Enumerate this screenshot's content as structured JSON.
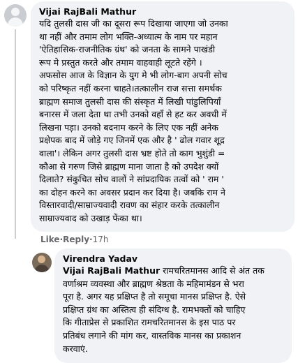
{
  "comments": [
    {
      "author": "Vijai RajBali Mathur",
      "text": "यदि तुलसी दास जी का दूसरा रूप दिखाया जाएगा जो उनका\nथा नहीं और तमाम लोग भक्ति-अध्यात्म के नाम पर महान\n'ऐतिहासिक-राजनीतिक ग्रंथ' को जनता के सामने पाखंडी\nरूप मे प्रस्तुत करते और तमाम वाहवाही लूटते रहेंगे ।\nअफसोस आज के विज्ञान के युग मे भी लोग-बाग अपनी सोच\nको परिष्कृत नहीं करना चाहते।तत्कालीन राज सत्ता समर्थक\nब्राह्मण समाज तुलसी दास की संस्कृत में लिखी पांडुलिपियाँ\nबनारस में जला देता था तभी उनको वहाँ से हट कर अवधी में\nलिखना पड़ा। उनको बदनाम करने के लिए एक नहीं अनेक\nप्रक्षेपक बाद में जोड़े गए जिनमें एक और है ' ढोल गवार शूद्र\nवाला'। लेकिन अगर तुलसी दास भ्रष्ट होते तो काग भुशुंडी =\nकौआ से गरुण जिसे ब्राह्मण माना जाता है को उपदेश क्यों\nदिलाते? संकुचित सोच वालों ने सांप्रदायिक तत्वों को ' राम '\nका दोहन करने का अवसर प्रदान कर दिया है। जबकि राम ने\nविस्तारवादी/साम्राज्यवादी रावण का संहार करके तत्कालीन\nसाम्राज्यवाद को उखाड़ फेंका था।",
      "actions": {
        "like": "Like",
        "sep1": " · ",
        "reply": "Reply",
        "sep2": " · ",
        "time": "17h"
      }
    },
    {
      "author": "Virendra Yadav",
      "mention": "Vijai RajBali Mathur",
      "text": " रामचरितमानस आदि से अंत तक\nवर्णाश्रम व्यवस्था और ब्राह्मण श्रेष्ठता के महिमामंडन से भरा\nपूरा है. अगर यह प्रक्षिप्त है तो समूचा मानस प्रक्षिप्त है. ऐसे\nप्रक्षिप्त ग्रंथ का अस्तित्व ही संदिग्ध है. रामभक्तों को चाहिए\nकि गीताप्रेस से प्रकाशित रामचरितमानस के इस पाठ पर\nप्रतिबंध लगाने की मांग कर, वास्तविक मानस का प्रकाशन\nकरवाएं."
    }
  ]
}
